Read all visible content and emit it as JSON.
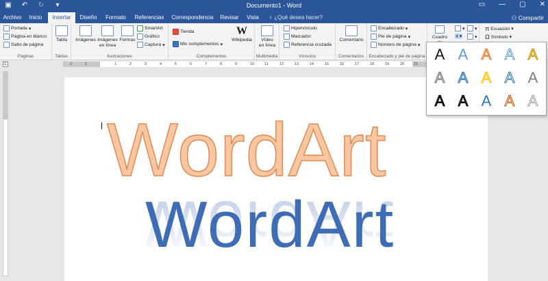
{
  "titlebar": {
    "title": "Documento1 - Word",
    "save_icon": "save-icon",
    "undo_icon": "undo-icon",
    "redo_icon": "redo-icon",
    "customize_icon": "customize-qat-icon"
  },
  "tabs": [
    {
      "label": "Archivo",
      "active": false
    },
    {
      "label": "Inicio",
      "active": false
    },
    {
      "label": "Insertar",
      "active": true
    },
    {
      "label": "Diseño",
      "active": false
    },
    {
      "label": "Formato",
      "active": false
    },
    {
      "label": "Referencias",
      "active": false
    },
    {
      "label": "Correspondencia",
      "active": false
    },
    {
      "label": "Revisar",
      "active": false
    },
    {
      "label": "Vista",
      "active": false
    }
  ],
  "tellme": "¿Qué desea hacer?",
  "share": "Compartir",
  "ribbon": {
    "paginas": {
      "items": [
        "Portada",
        "Página en blanco",
        "Salto de página"
      ],
      "label": "Páginas"
    },
    "tablas": {
      "button": "Tabla",
      "label": "Tablas"
    },
    "ilustraciones": {
      "imagenes": "Imágenes",
      "imagenes_linea_1": "Imágenes",
      "imagenes_linea_2": "en línea",
      "formas": "Formas",
      "smartart": "SmartArt",
      "grafico": "Gráfico",
      "captura": "Captura",
      "label": "Ilustraciones"
    },
    "complementos": {
      "tienda": "Tienda",
      "mis": "Mis complementos",
      "wikipedia": "Wikipedia",
      "label": "Complementos"
    },
    "multimedia": {
      "video_1": "Vídeo",
      "video_2": "en línea",
      "label": "Multimedia"
    },
    "vinculos": {
      "items": [
        "Hipervínculo",
        "Marcador",
        "Referencia cruzada"
      ],
      "label": "Vínculos"
    },
    "comentarios": {
      "button": "Comentario",
      "label": "Comentarios"
    },
    "encabezado": {
      "items": [
        "Encabezado",
        "Pie de página",
        "Número de página"
      ],
      "label": "Encabezado y pie de página"
    },
    "texto": {
      "cuadro": "Cuadro de"
    },
    "simbolos": {
      "ecuacion": "Ecuación",
      "simbolo": "Símbolo"
    }
  },
  "ruler_numbers": [
    "2",
    "1",
    "1",
    "2",
    "3",
    "4",
    "5",
    "6",
    "7",
    "8",
    "9",
    "10",
    "11",
    "12",
    "13",
    "14",
    "15",
    "16",
    "17",
    "18",
    "19",
    "20",
    "21"
  ],
  "document": {
    "wordart_1": "WordArt",
    "wordart_2": "WordArt"
  },
  "gallery": {
    "glyph": "A",
    "styles": [
      {
        "fill": "#111111",
        "stroke": "none"
      },
      {
        "fill": "#5b9bd5",
        "stroke": "none"
      },
      {
        "fill": "#f4b183",
        "stroke": "#ed7d31"
      },
      {
        "fill": "#ffffff",
        "stroke": "#5b9bd5"
      },
      {
        "fill": "#ffd966",
        "stroke": "#bf9000"
      },
      {
        "fill": "#bfbfbf",
        "stroke": "#7f7f7f"
      },
      {
        "fill": "#9dc3e6",
        "stroke": "#2e75b6"
      },
      {
        "fill": "#ffe699",
        "stroke": "#ffc000"
      },
      {
        "fill": "#ffffff",
        "stroke": "#2e75b6"
      },
      {
        "fill": "#7f7f7f",
        "stroke": "none"
      },
      {
        "fill": "#262626",
        "stroke": "#000000"
      },
      {
        "fill": "#404040",
        "stroke": "#000000"
      },
      {
        "fill": "#2e75b6",
        "stroke": "none"
      },
      {
        "fill": "#fbe5d6",
        "stroke": "#c55a11"
      },
      {
        "fill": "#f2f2f2",
        "stroke": "#a6a6a6"
      }
    ]
  },
  "colors": {
    "brand": "#2b579a",
    "ribbon_bg": "#f3f3f3",
    "wordart_orange_fill": "#f7c7a4",
    "wordart_orange_stroke": "#e38a4d",
    "wordart_blue": "#3e6db5"
  }
}
